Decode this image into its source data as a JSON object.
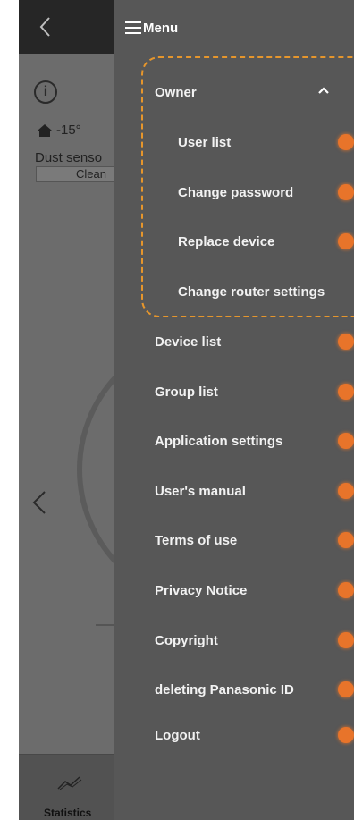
{
  "background": {
    "temperature": "-15°",
    "dust_sensor_label": "Dust senso",
    "dust_status": "Clean",
    "bottom_tab_label": "Statistics"
  },
  "menu": {
    "title": "Menu",
    "owner": {
      "label": "Owner",
      "expanded": true,
      "items": [
        {
          "label": "User list"
        },
        {
          "label": "Change password"
        },
        {
          "label": "Replace device"
        },
        {
          "label": "Change router settings"
        }
      ]
    },
    "items": [
      {
        "label": "Device list"
      },
      {
        "label": "Group list"
      },
      {
        "label": "Application settings"
      },
      {
        "label": "User's manual"
      },
      {
        "label": "Terms of use"
      },
      {
        "label": "Privacy Notice"
      },
      {
        "label": "Copyright"
      },
      {
        "label": "deleting Panasonic ID"
      },
      {
        "label": "Logout"
      }
    ]
  },
  "colors": {
    "accent_orange": "#e8742a",
    "menu_background": "#575757",
    "highlight_dash": "#e6962c"
  }
}
